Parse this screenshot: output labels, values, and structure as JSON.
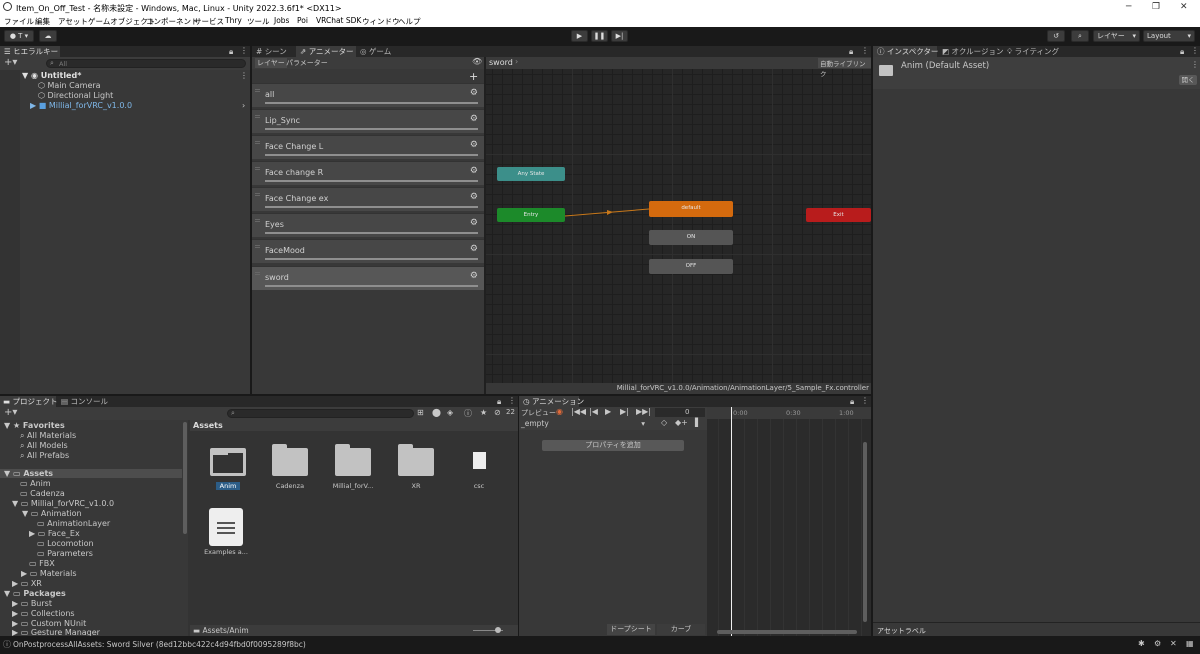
{
  "window": {
    "title": "Item_On_Off_Test - 名称未設定 - Windows, Mac, Linux - Unity 2022.3.6f1* <DX11>"
  },
  "menu": [
    "ファイル",
    "編集",
    "アセット",
    "ゲームオブジェクト",
    "コンポーネント",
    "サービス",
    "Thry",
    "ツール",
    "Jobs",
    "Poi",
    "VRChat SDK",
    "ウィンドウ",
    "ヘルプ"
  ],
  "toolbar": {
    "account": "T ▾",
    "layers": "レイヤー",
    "layout": "Layout"
  },
  "hierarchy": {
    "tab": "ヒエラルキー",
    "search_placeholder": "All",
    "scene": "Untitled*",
    "items": [
      "Main Camera",
      "Directional Light",
      "Millial_forVRC_v1.0.0"
    ]
  },
  "center_tabs": [
    "シーン",
    "アニメーター",
    "ゲーム"
  ],
  "animator": {
    "subtabs": [
      "レイヤー",
      "パラメーター"
    ],
    "breadcrumb": "sword",
    "auto_live_link": "自動ライブリンク",
    "layers": [
      "all",
      "Lip_Sync",
      "Face Change L",
      "Face change R",
      "Face Change ex",
      "Eyes",
      "FaceMood",
      "sword"
    ],
    "nodes": {
      "any_state": "Any State",
      "entry": "Entry",
      "default": "default",
      "exit": "Exit",
      "on": "ON",
      "off": "OFF"
    },
    "path": "Millial_forVRC_v1.0.0/Animation/AnimationLayer/5_Sample_Fx.controller"
  },
  "right_tabs": [
    "インスペクター",
    "オクルージョン",
    "ライティング"
  ],
  "inspector": {
    "title": "Anim (Default Asset)",
    "open_button": "開く",
    "asset_labels": "アセットラベル"
  },
  "project": {
    "tabs": [
      "プロジェクト",
      "コンソール"
    ],
    "badge": "22",
    "favorites_label": "Favorites",
    "favorites": [
      "All Materials",
      "All Models",
      "All Prefabs"
    ],
    "assets_label": "Assets",
    "tree": [
      "Anim",
      "Cadenza",
      "Millial_forVRC_v1.0.0",
      "Animation",
      "AnimationLayer",
      "Face_Ex",
      "Locomotion",
      "Parameters",
      "FBX",
      "Materials",
      "XR"
    ],
    "packages_label": "Packages",
    "packages": [
      "Burst",
      "Collections",
      "Custom NUnit",
      "Gesture Manager"
    ],
    "breadcrumb": "Assets",
    "grid": [
      "Anim",
      "Cadenza",
      "Millial_forV...",
      "XR",
      "csc",
      "Examples a..."
    ],
    "footer_path": "Assets/Anim"
  },
  "animation": {
    "tab": "アニメーション",
    "preview": "プレビュー",
    "frame": "0",
    "clip": "_empty",
    "add_property": "プロパティを追加",
    "dopesheet": "ドープシート",
    "curves": "カーブ",
    "time_labels": [
      "0:00",
      "0:30",
      "1:00"
    ]
  },
  "status": {
    "message": "OnPostprocessAllAssets: Sword Silver (8ed12bbc422c4d94fbd0f0095289f8bc)"
  }
}
